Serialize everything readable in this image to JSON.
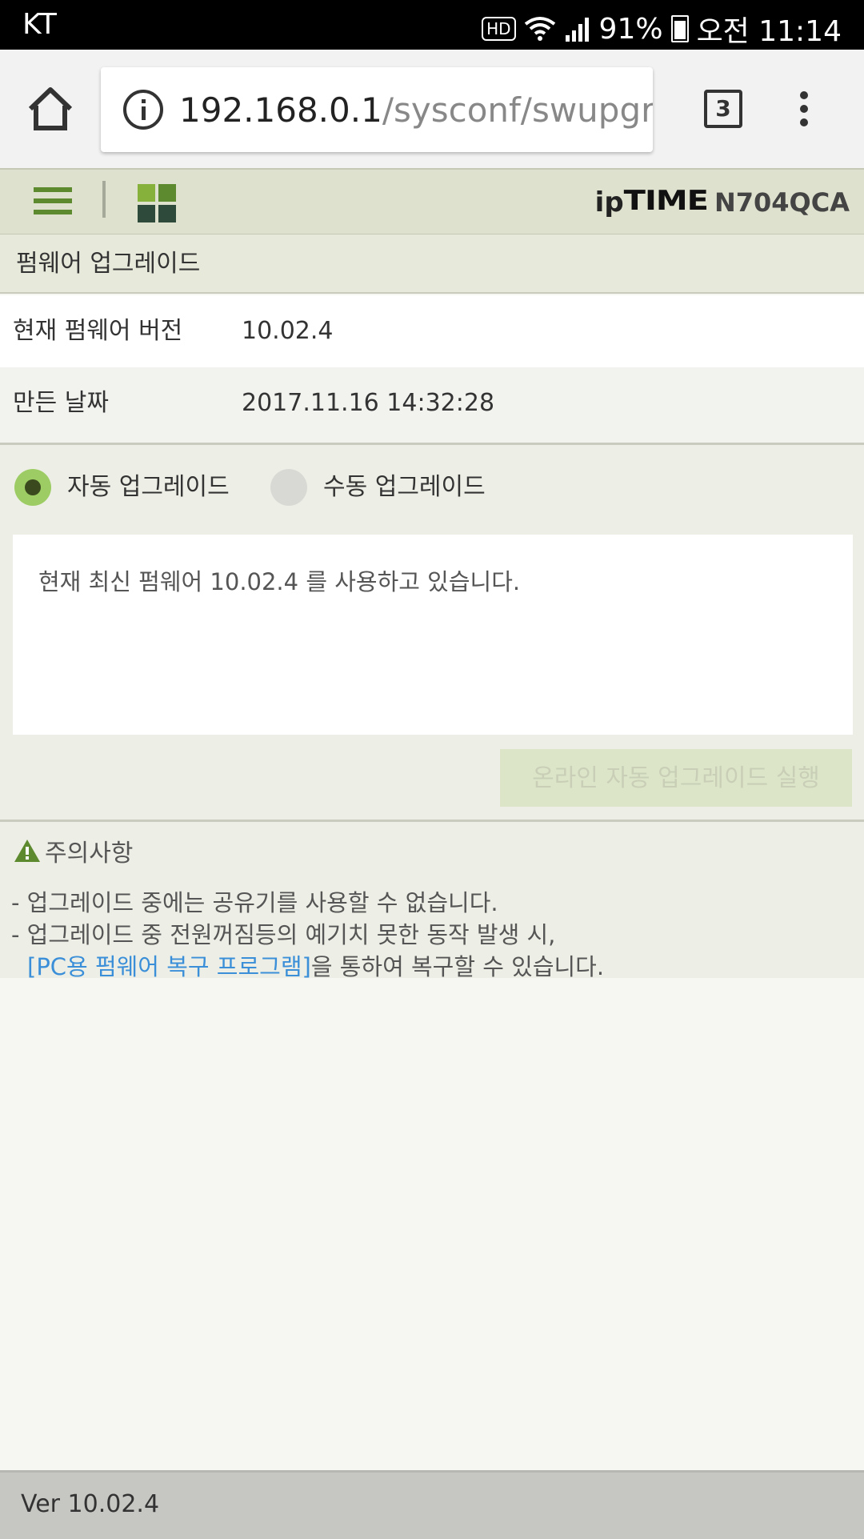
{
  "status_bar": {
    "carrier": "KT",
    "hd": "HD",
    "battery": "91%",
    "time": "오전 11:14"
  },
  "browser": {
    "url_host": "192.168.0.1",
    "url_path": "/sysconf/swupgrade",
    "tab_count": "3"
  },
  "header": {
    "brand_ip": "ip",
    "brand_time": "TIME",
    "model": "N704QCA"
  },
  "page": {
    "title": "펌웨어 업그레이드"
  },
  "info": {
    "version_label": "현재 펌웨어 버전",
    "version_value": "10.02.4",
    "date_label": "만든 날짜",
    "date_value": "2017.11.16 14:32:28"
  },
  "upgrade": {
    "auto_label": "자동 업그레이드",
    "manual_label": "수동 업그레이드",
    "selected": "auto",
    "message": "현재 최신 펌웨어 10.02.4 를 사용하고 있습니다.",
    "run_button": "온라인 자동 업그레이드 실행"
  },
  "notes": {
    "title": "주의사항",
    "line1": "- 업그레이드 중에는 공유기를 사용할 수 없습니다.",
    "line2": "- 업그레이드 중 전원꺼짐등의 예기치 못한 동작 발생 시,",
    "link": "[PC용 펌웨어 복구 프로그램]",
    "line3_suffix": "을 통하여 복구할 수 있습니다."
  },
  "footer": {
    "version": "Ver 10.02.4"
  },
  "colors": {
    "accent_green": "#5e8a2f",
    "link_blue": "#3b8fd8"
  }
}
